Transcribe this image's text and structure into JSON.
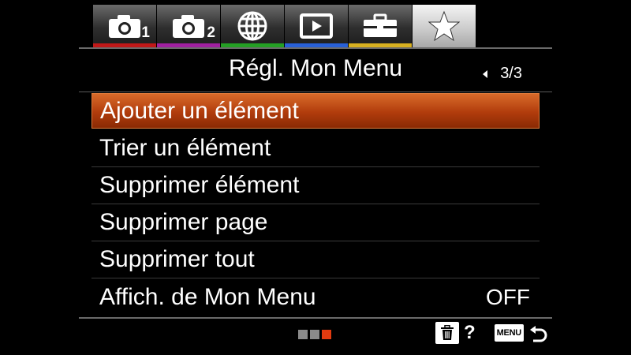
{
  "tabs": [
    {
      "icon": "camera-icon",
      "number": "1",
      "color": "#c01818",
      "active": false
    },
    {
      "icon": "camera-icon",
      "number": "2",
      "color": "#a020a0",
      "active": false
    },
    {
      "icon": "globe-icon",
      "number": "",
      "color": "#24a024",
      "active": false
    },
    {
      "icon": "playback-icon",
      "number": "",
      "color": "#2860d8",
      "active": false
    },
    {
      "icon": "toolbox-icon",
      "number": "",
      "color": "#d8b020",
      "active": false
    },
    {
      "icon": "star-icon",
      "number": "",
      "color": "#9a9a9a",
      "active": true
    }
  ],
  "header": {
    "title": "Régl. Mon Menu",
    "page_indicator": "3/3"
  },
  "menu_items": [
    {
      "label": "Ajouter un élément",
      "value": "",
      "selected": true
    },
    {
      "label": "Trier un élément",
      "value": "",
      "selected": false
    },
    {
      "label": "Supprimer élément",
      "value": "",
      "selected": false
    },
    {
      "label": "Supprimer page",
      "value": "",
      "selected": false
    },
    {
      "label": "Supprimer tout",
      "value": "",
      "selected": false
    },
    {
      "label": "Affich. de Mon Menu",
      "value": "OFF",
      "selected": false
    }
  ],
  "footer": {
    "help_label": "?",
    "menu_label": "MENU",
    "page_dots": [
      false,
      false,
      true
    ]
  },
  "colors": {
    "selection": "#c04a14",
    "active_dot": "#e23b10"
  }
}
